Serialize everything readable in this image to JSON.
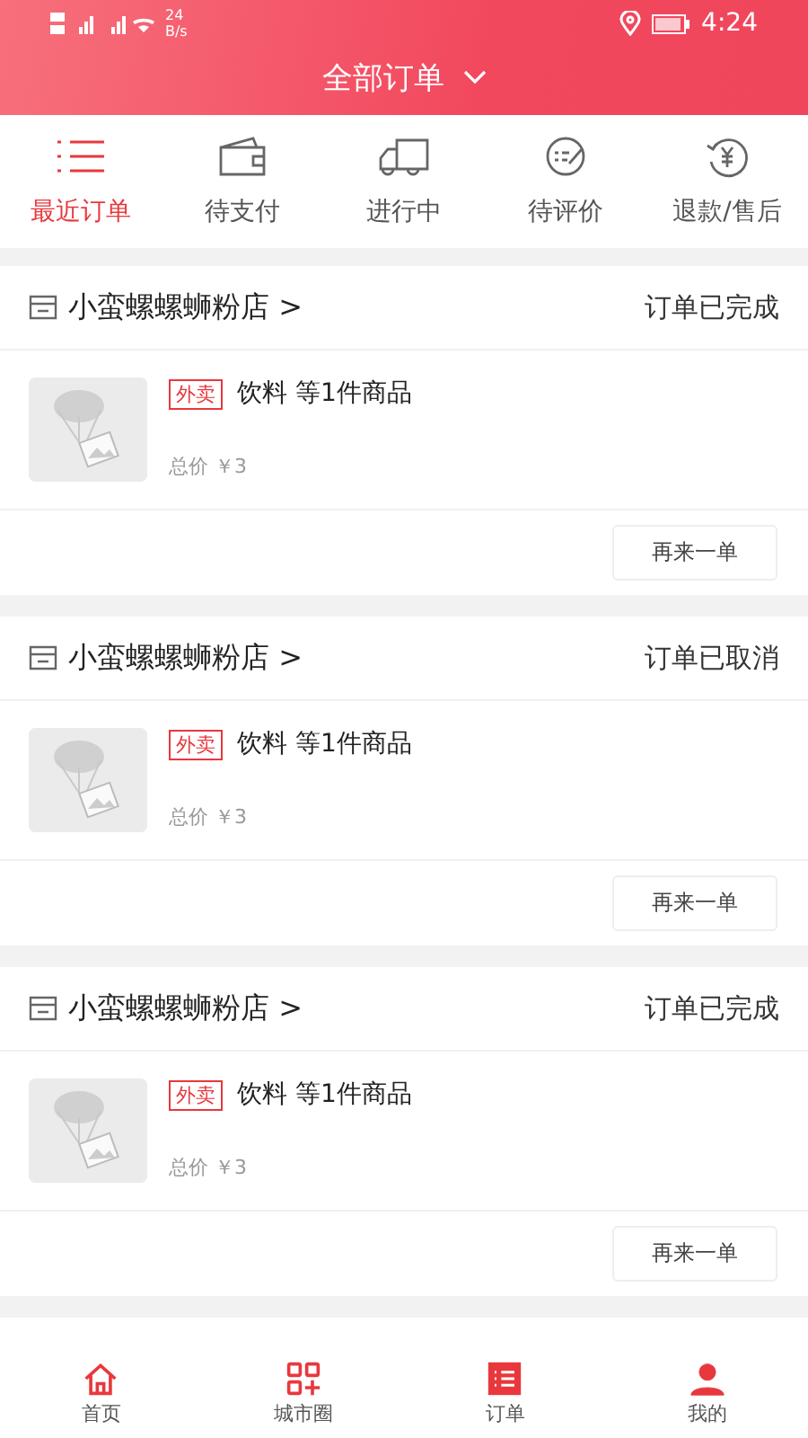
{
  "status_bar": {
    "speed": "24",
    "speed_unit": "B/s",
    "time": "4:24"
  },
  "header": {
    "title": "全部订单"
  },
  "tabs": [
    {
      "label": "最近订单",
      "kind": "list",
      "selected": true
    },
    {
      "label": "待支付",
      "kind": "wallet",
      "selected": false
    },
    {
      "label": "进行中",
      "kind": "truck",
      "selected": false
    },
    {
      "label": "待评价",
      "kind": "review",
      "selected": false
    },
    {
      "label": "退款/售后",
      "kind": "refund",
      "selected": false
    }
  ],
  "orders": [
    {
      "shop": "小蛮螺螺蛳粉店 >",
      "status": "订单已完成",
      "tag": "外卖",
      "items": "饮料 等1件商品",
      "total": "总价 ￥3",
      "action": "再来一单"
    },
    {
      "shop": "小蛮螺螺蛳粉店 >",
      "status": "订单已取消",
      "tag": "外卖",
      "items": "饮料 等1件商品",
      "total": "总价 ￥3",
      "action": "再来一单"
    },
    {
      "shop": "小蛮螺螺蛳粉店 >",
      "status": "订单已完成",
      "tag": "外卖",
      "items": "饮料 等1件商品",
      "total": "总价 ￥3",
      "action": "再来一单"
    }
  ],
  "bottom_nav": [
    {
      "label": "首页",
      "kind": "home",
      "selected": false
    },
    {
      "label": "城市圈",
      "kind": "grid",
      "selected": false
    },
    {
      "label": "订单",
      "kind": "orders",
      "selected": true
    },
    {
      "label": "我的",
      "kind": "person",
      "selected": false
    }
  ]
}
